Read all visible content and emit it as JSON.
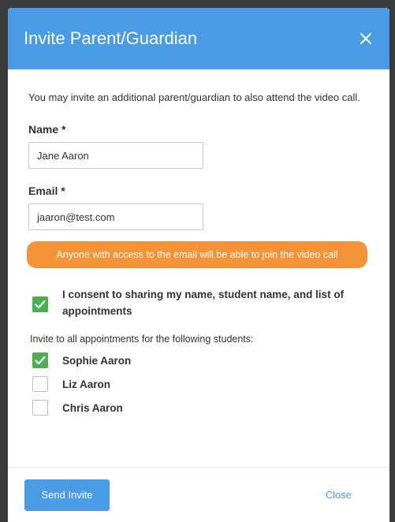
{
  "modal": {
    "title": "Invite Parent/Guardian",
    "close_icon": "close-icon",
    "intro": "You may invite an additional parent/guardian to also attend the video call.",
    "name_label": "Name *",
    "name_value": "Jane Aaron",
    "email_label": "Email *",
    "email_value": "jaaron@test.com",
    "warning": "Anyone with access to the email will be able to join the video call",
    "consent_label": "I consent to sharing my name, student name, and list of appointments",
    "consent_checked": true,
    "students_title": "Invite to all appointments for the following students:",
    "students": [
      {
        "name": "Sophie Aaron",
        "checked": true
      },
      {
        "name": "Liz Aaron",
        "checked": false
      },
      {
        "name": "Chris Aaron",
        "checked": false
      }
    ],
    "send_label": "Send Invite",
    "close_label": "Close"
  },
  "colors": {
    "header": "#4a9be6",
    "warning": "#f39237",
    "check": "#4caf50",
    "backdrop": "#3c3c3c"
  }
}
